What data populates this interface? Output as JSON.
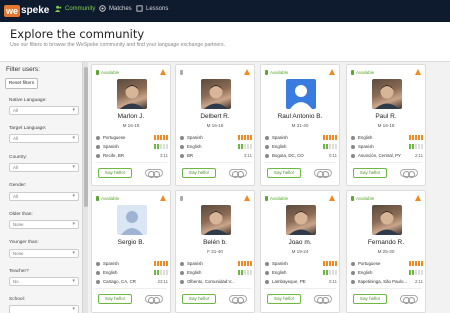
{
  "topbar": {
    "logo_prefix": "we",
    "logo_suffix": "speke",
    "nav": [
      {
        "label": "Community",
        "icon": "community-icon",
        "active": true
      },
      {
        "label": "Matches",
        "icon": "matches-icon",
        "active": false
      },
      {
        "label": "Lessons",
        "icon": "lessons-icon",
        "active": false
      }
    ]
  },
  "header": {
    "title": "Explore the community",
    "subtitle": "Use our filters to browse the WeSpeke community and find your language exchange partners."
  },
  "sidebar": {
    "title": "Filter users:",
    "reset_label": "Reset filters",
    "filters": [
      {
        "label": "Native Language:",
        "value": "All"
      },
      {
        "label": "Target Language:",
        "value": "All"
      },
      {
        "label": "Country:",
        "value": "All"
      },
      {
        "label": "Gender:",
        "value": "All"
      },
      {
        "label": "Older than:",
        "value": "None"
      },
      {
        "label": "Younger than:",
        "value": "None"
      },
      {
        "label": "Teacher?",
        "value": "No"
      },
      {
        "label": "School:",
        "value": ""
      }
    ]
  },
  "cards": [
    {
      "available": "Available",
      "name": "Marlon J.",
      "meta": "M 16-18",
      "lang1": "Portuguese",
      "lang1_level": 5,
      "lang2": "Spanish",
      "lang2_level": 2,
      "location": "Recife, BR",
      "time": "3:11",
      "avatar": "photo"
    },
    {
      "available": "",
      "name": "Delbert R.",
      "meta": "M 16-18",
      "lang1": "Spanish",
      "lang1_level": 5,
      "lang2": "English",
      "lang2_level": 2,
      "location": "BR",
      "time": "3:11",
      "avatar": "photo"
    },
    {
      "available": "Available",
      "name": "Raul Antonio B.",
      "meta": "M 31-40",
      "lang1": "Spanish",
      "lang1_level": 5,
      "lang2": "English",
      "lang2_level": 2,
      "location": "Bogota, DC, CO",
      "time": "0:11",
      "avatar": "default-blue"
    },
    {
      "available": "Available",
      "name": "Paul R.",
      "meta": "M 16-18",
      "lang1": "English",
      "lang1_level": 5,
      "lang2": "Spanish",
      "lang2_level": 2,
      "location": "Asunción, Central, PY",
      "time": "2:11",
      "avatar": "photo"
    },
    {
      "available": "Available",
      "name": "Sergio B.",
      "meta": "",
      "lang1": "Spanish",
      "lang1_level": 5,
      "lang2": "English",
      "lang2_level": 2,
      "location": "Cartago, CA, CR",
      "time": "23:11",
      "avatar": "default-light"
    },
    {
      "available": "",
      "name": "Belén b.",
      "meta": "F 31-40",
      "lang1": "Spanish",
      "lang1_level": 5,
      "lang2": "English",
      "lang2_level": 2,
      "location": "Olbento, Comunidad V...",
      "time": "",
      "avatar": "photo"
    },
    {
      "available": "Available",
      "name": "Joao m.",
      "meta": "M 19-24",
      "lang1": "Spanish",
      "lang1_level": 5,
      "lang2": "English",
      "lang2_level": 2,
      "location": "Lambayeque, PE",
      "time": "0:11",
      "avatar": "photo"
    },
    {
      "available": "Available",
      "name": "Fernando R.",
      "meta": "M 25-30",
      "lang1": "Portuguese",
      "lang1_level": 5,
      "lang2": "English",
      "lang2_level": 2,
      "location": "Itapetininga, São Paulo...",
      "time": "2:11",
      "avatar": "photo"
    }
  ],
  "card_button_label": "Say hello!",
  "colors": {
    "topbar": "#0e1a2e",
    "accent_green": "#6cb841",
    "accent_orange": "#f08a24",
    "logo_orange": "#e8772e"
  }
}
